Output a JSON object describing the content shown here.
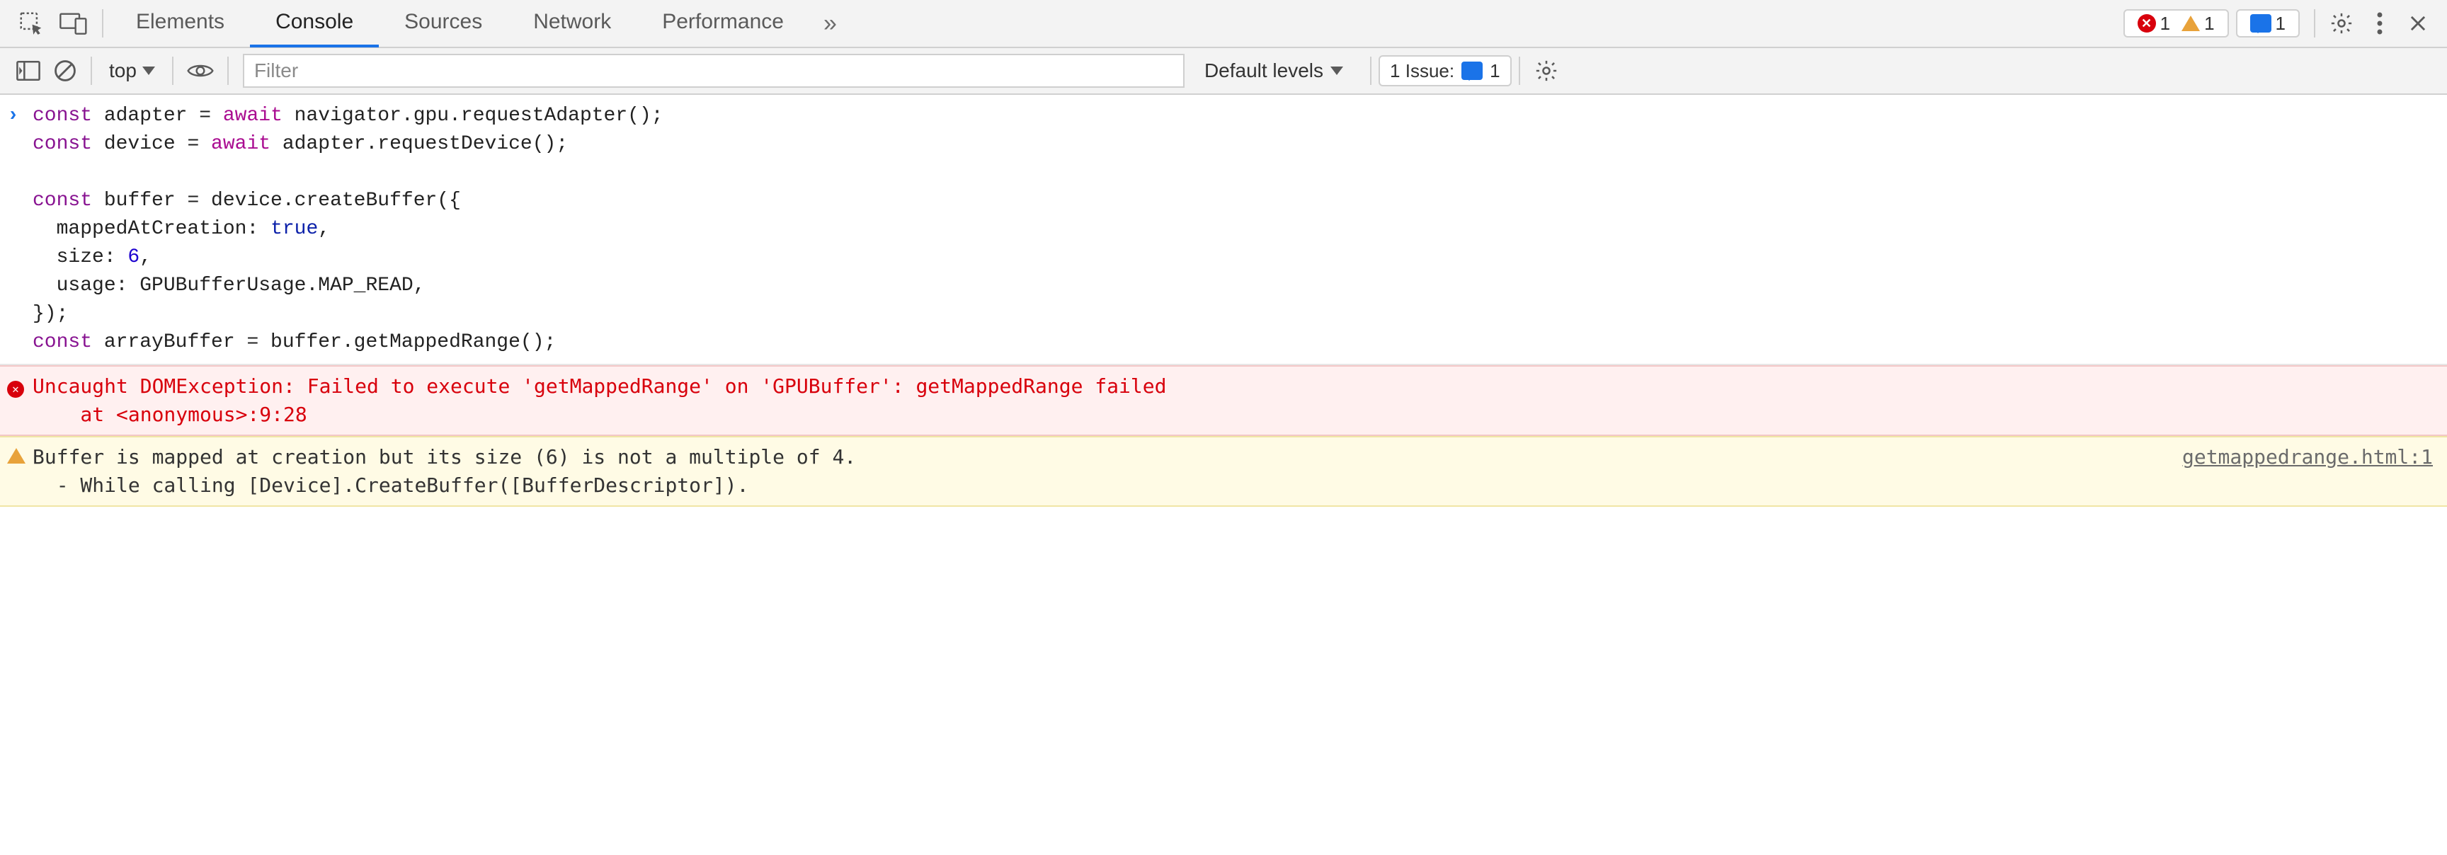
{
  "tabs": {
    "items": [
      "Elements",
      "Console",
      "Sources",
      "Network",
      "Performance"
    ],
    "active_index": 1,
    "overflow_glyph": "»"
  },
  "status": {
    "error_count": "1",
    "warning_count": "1",
    "info_count": "1"
  },
  "toolbar": {
    "context_label": "top",
    "filter_placeholder": "Filter",
    "levels_label": "Default levels",
    "issues_label": "1 Issue:",
    "issues_count": "1"
  },
  "code": {
    "lines": [
      [
        [
          "kw",
          "const"
        ],
        [
          "plain",
          " adapter = "
        ],
        [
          "aw",
          "await"
        ],
        [
          "plain",
          " navigator.gpu.requestAdapter();"
        ]
      ],
      [
        [
          "kw",
          "const"
        ],
        [
          "plain",
          " device = "
        ],
        [
          "aw",
          "await"
        ],
        [
          "plain",
          " adapter.requestDevice();"
        ]
      ],
      null,
      [
        [
          "kw",
          "const"
        ],
        [
          "plain",
          " buffer = device.createBuffer({"
        ]
      ],
      [
        [
          "plain",
          "  mappedAtCreation: "
        ],
        [
          "bool",
          "true"
        ],
        [
          "plain",
          ","
        ]
      ],
      [
        [
          "plain",
          "  size: "
        ],
        [
          "num",
          "6"
        ],
        [
          "plain",
          ","
        ]
      ],
      [
        [
          "plain",
          "  usage: GPUBufferUsage.MAP_READ,"
        ]
      ],
      [
        [
          "plain",
          "});"
        ]
      ],
      [
        [
          "kw",
          "const"
        ],
        [
          "plain",
          " arrayBuffer = buffer.getMappedRange();"
        ]
      ]
    ]
  },
  "messages": {
    "error": {
      "line1": "Uncaught DOMException: Failed to execute 'getMappedRange' on 'GPUBuffer': getMappedRange failed",
      "line2": "    at <anonymous>:9:28"
    },
    "warn": {
      "line1": "Buffer is mapped at creation but its size (6) is not a multiple of 4.",
      "line2": "  - While calling [Device].CreateBuffer([BufferDescriptor]).",
      "source": "getmappedrange.html:1"
    }
  }
}
